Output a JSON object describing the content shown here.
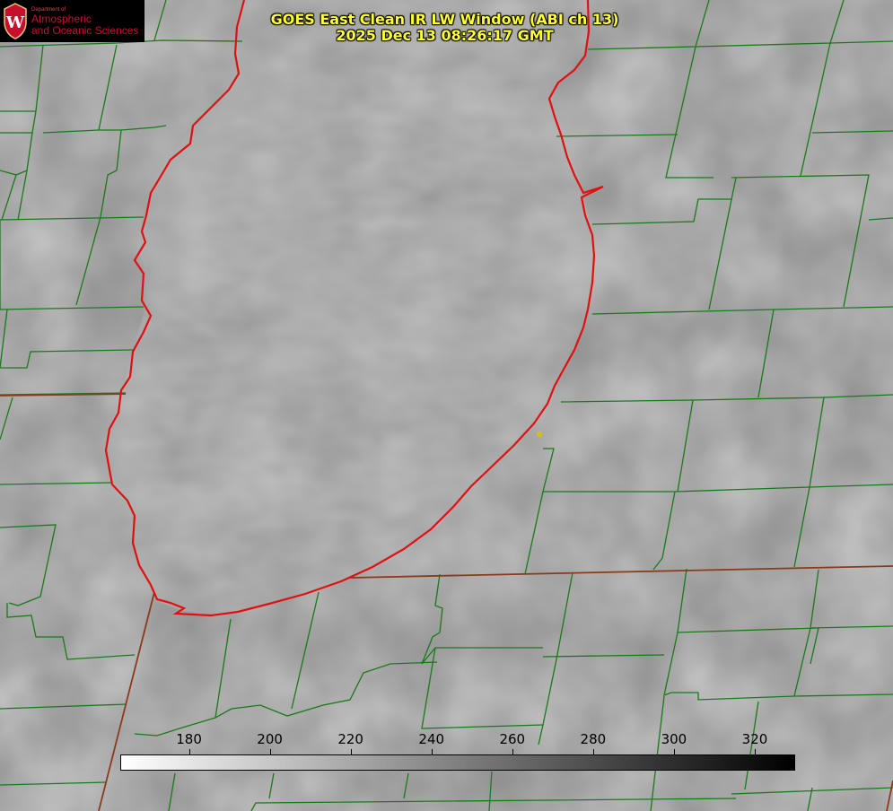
{
  "title": {
    "line1": "GOES East Clean IR LW Window (ABI ch 13)",
    "line2": "2025 Dec 13 08:26:17 GMT"
  },
  "logo": {
    "dept": "Department of",
    "line1": "Atmospheric",
    "line2": "and Oceanic Sciences",
    "seal_letter": "W",
    "color": "#c8102e"
  },
  "colorbar": {
    "min": 163,
    "max": 330,
    "ticks": [
      180,
      200,
      220,
      240,
      260,
      280,
      300,
      320
    ],
    "gradient": [
      "#ffffff",
      "#000000"
    ]
  },
  "colors": {
    "county_lines": "#1a7a1a",
    "state_lines": "#8b3a1a",
    "lake_shoreline": "#e01010",
    "marker": "#d4c400",
    "title": "#ffff33"
  },
  "icons": {
    "location_marker": "dot-icon"
  }
}
